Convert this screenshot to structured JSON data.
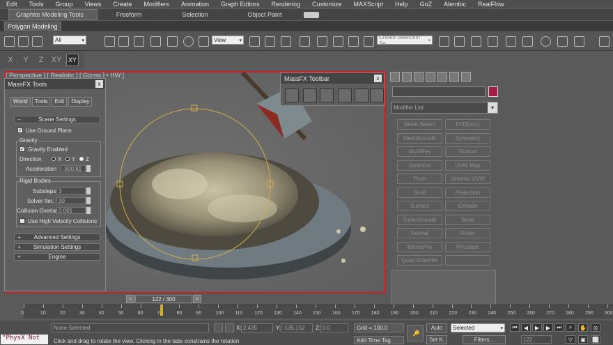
{
  "menu": [
    "Edit",
    "Tools",
    "Group",
    "Views",
    "Create",
    "Modifiers",
    "Animation",
    "Graph Editors",
    "Rendering",
    "Customize",
    "MAXScript",
    "Help",
    "GoZ",
    "Alembic",
    "RealFlow"
  ],
  "ribbon": {
    "tabs": [
      "Graphite Modeling Tools",
      "Freeform",
      "Selection",
      "Object Paint"
    ],
    "subtab": "Polygon Modeling"
  },
  "toolbar": {
    "filter_value": "All",
    "coord_value": "View",
    "named_selection_placeholder": "Create Selection Se"
  },
  "axis": {
    "buttons": [
      "X",
      "Y",
      "Z",
      "XY",
      "XY"
    ]
  },
  "viewport": {
    "label": "[ Perspective ] [ Realistic ] [ Gizmo ] • HW ]"
  },
  "massfx_tools": {
    "title": "MassFX Tools",
    "close": "x",
    "tabs": [
      "World",
      "Tools",
      "Edit",
      "Display"
    ],
    "scene_settings": "Scene Settings",
    "use_ground_plane": "Use Ground Plane",
    "gravity_group": "Gravity",
    "gravity_enabled": "Gravity Enabled",
    "direction_label": "Direction",
    "dir_x": "X",
    "dir_y": "Y",
    "dir_z": "Z",
    "acceleration_label": "Acceleration",
    "acceleration_value": "-900.81",
    "rigid_group": "Rigid Bodies",
    "substeps_label": "Substeps",
    "substeps_value": "3",
    "solver_label": "Solver Iter.",
    "solver_value": "30",
    "collision_label": "Collision Overlap",
    "collision_value": "0.001",
    "high_velocity": "Use High Velocity Collisions",
    "advanced_settings": "Advanced Settings",
    "simulation_settings": "Simulation Settings",
    "engine": "Engine",
    "minus": "–",
    "plus": "+"
  },
  "massfx_toolbar": {
    "title": "MassFX Toolbar",
    "close": "x"
  },
  "command_panel": {
    "modifier_list": "Modifier List",
    "modifiers": [
      "Mesh Select",
      "FFD(box)",
      "MeshSmooth",
      "Symmetry",
      "MultiRes",
      "Normal",
      "Optimize",
      "UVW Map",
      "Push",
      "Unwrap UVW",
      "Shell",
      "Projection",
      "Surface",
      "Extrude",
      "TurboSmooth",
      "Bend",
      "Normal",
      "Relax",
      "BonesPro",
      "Physique",
      "Quad Chamfer",
      ""
    ],
    "colors": {
      "object_color": "#a11d46"
    }
  },
  "time": {
    "position": "122 / 300",
    "prev": "<",
    "next": ">",
    "ticks": [
      "0",
      "10",
      "20",
      "30",
      "40",
      "50",
      "60",
      "70",
      "80",
      "90",
      "100",
      "110",
      "120",
      "130",
      "140",
      "150",
      "160",
      "170",
      "180",
      "190",
      "200",
      "210",
      "220",
      "230",
      "240",
      "250",
      "260",
      "270",
      "280",
      "290",
      "300"
    ]
  },
  "status": {
    "physx": "\"PhysX Not",
    "selection": "None Selected",
    "prompt": "Click and drag to rotate the view.  Clicking in the tabs constrains the rotation",
    "x_label": "X:",
    "x_value": "2.435",
    "y_label": "Y:",
    "y_value": "-135.152",
    "z_label": "Z:",
    "z_value": "0.0",
    "grid": "Grid = 100.0",
    "add_time_tag": "Add Time Tag",
    "auto": "Auto",
    "set_key": "Set K.",
    "selected": "Selected",
    "filters": "Filters...",
    "frame": "122"
  }
}
